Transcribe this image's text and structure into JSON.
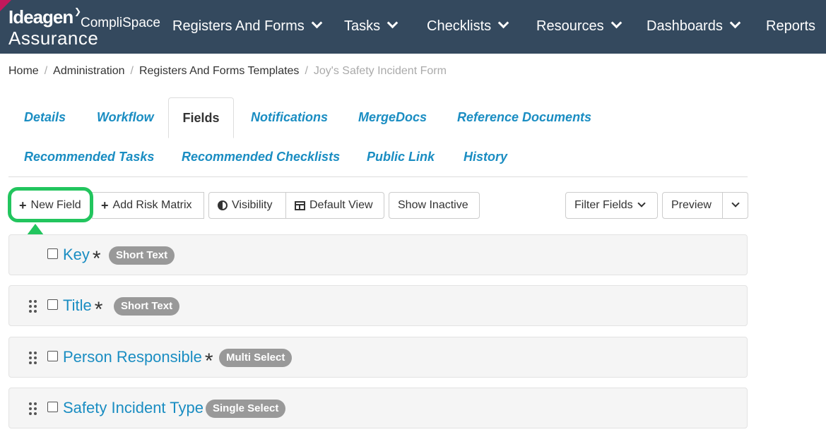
{
  "brand": {
    "ideagen": "Ideagen",
    "complispace": "CompliSpace",
    "assurance": "Assurance"
  },
  "nav": {
    "items": [
      {
        "label": "Registers And Forms",
        "has_dropdown": true
      },
      {
        "label": "Tasks",
        "has_dropdown": true
      },
      {
        "label": "Checklists",
        "has_dropdown": true
      },
      {
        "label": "Resources",
        "has_dropdown": true
      },
      {
        "label": "Dashboards",
        "has_dropdown": true
      },
      {
        "label": "Reports",
        "has_dropdown": false
      }
    ]
  },
  "breadcrumb": {
    "items": [
      "Home",
      "Administration",
      "Registers And Forms Templates"
    ],
    "current": "Joy's Safety Incident Form",
    "separator": "/"
  },
  "tabs": [
    {
      "label": "Details"
    },
    {
      "label": "Workflow"
    },
    {
      "label": "Fields",
      "active": true
    },
    {
      "label": "Notifications"
    },
    {
      "label": "MergeDocs"
    },
    {
      "label": "Reference Documents"
    },
    {
      "label": "Recommended Tasks"
    },
    {
      "label": "Recommended Checklists"
    },
    {
      "label": "Public Link"
    },
    {
      "label": "History"
    }
  ],
  "toolbar": {
    "new_field": "New Field",
    "add_risk_matrix": "Add Risk Matrix",
    "visibility": "Visibility",
    "default_view": "Default View",
    "show_inactive": "Show Inactive",
    "filter_fields": "Filter Fields",
    "preview": "Preview"
  },
  "fields": [
    {
      "name": "Key",
      "required": true,
      "type": "Short Text",
      "draggable": false
    },
    {
      "name": "Title",
      "required": true,
      "type": "Short Text",
      "draggable": true
    },
    {
      "name": "Person Responsible",
      "required": true,
      "type": "Multi Select",
      "draggable": true
    },
    {
      "name": "Safety Incident Type",
      "required": false,
      "type": "Single Select",
      "draggable": true
    }
  ],
  "colors": {
    "navbar": "#34495e",
    "link": "#1a8dc2",
    "highlight": "#22c55e",
    "badge": "#999999"
  }
}
